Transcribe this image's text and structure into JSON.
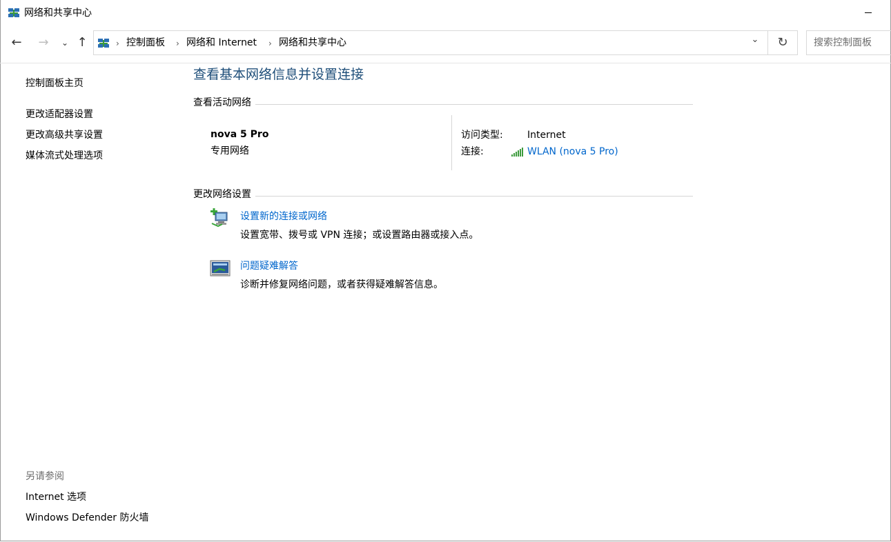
{
  "window": {
    "title": "网络和共享中心"
  },
  "navigation": {
    "breadcrumbs": [
      "控制面板",
      "网络和 Internet",
      "网络和共享中心"
    ],
    "search_placeholder": "搜索控制面板",
    "back_icon": "arrow-left-icon",
    "forward_icon": "arrow-right-icon",
    "up_icon": "arrow-up-icon",
    "refresh_icon": "refresh-icon"
  },
  "sidebar": {
    "home_link": "控制面板主页",
    "links": [
      "更改适配器设置",
      "更改高级共享设置",
      "媒体流式处理选项"
    ],
    "see_also_heading": "另请参阅",
    "see_also_links": [
      "Internet 选项",
      "Windows Defender 防火墙"
    ]
  },
  "main": {
    "title": "查看基本网络信息并设置连接",
    "active_networks_heading": "查看活动网络",
    "network": {
      "name": "nova 5 Pro",
      "category": "专用网络",
      "access_type_label": "访问类型:",
      "access_type_value": "Internet",
      "connection_label": "连接:",
      "connection_value": "WLAN (nova 5 Pro)"
    },
    "change_settings_heading": "更改网络设置",
    "tasks": [
      {
        "title": "设置新的连接或网络",
        "description": "设置宽带、拨号或 VPN 连接；或设置路由器或接入点。",
        "icon": "new-connection-icon"
      },
      {
        "title": "问题疑难解答",
        "description": "诊断并修复网络问题，或者获得疑难解答信息。",
        "icon": "troubleshoot-icon"
      }
    ]
  },
  "colors": {
    "link": "#0066cc",
    "page_title": "#1e4e79",
    "muted": "#6d6d6d",
    "divider": "#d5d5d5"
  }
}
